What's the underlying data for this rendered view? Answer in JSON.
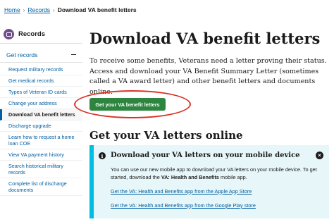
{
  "breadcrumb": {
    "items": [
      "Home",
      "Records"
    ],
    "current": "Download VA benefit letters",
    "separator": "›"
  },
  "sidebar": {
    "icon": "records-icon",
    "title": "Records",
    "section": "Get records",
    "section_toggle_icon": "minus-icon",
    "items": [
      {
        "label": "Request military records",
        "active": false
      },
      {
        "label": "Get medical records",
        "active": false
      },
      {
        "label": "Types of Veteran ID cards",
        "active": false
      },
      {
        "label": "Change your address",
        "active": false
      },
      {
        "label": "Download VA benefit letters",
        "active": true
      },
      {
        "label": "Discharge upgrade",
        "active": false
      },
      {
        "label": "Learn how to request a home loan COE",
        "active": false
      },
      {
        "label": "View VA payment history",
        "active": false
      },
      {
        "label": "Search historical military records",
        "active": false
      },
      {
        "label": "Complete list of discharge documents",
        "active": false
      }
    ]
  },
  "main": {
    "title": "Download VA benefit letters",
    "intro": "To receive some benefits, Veterans need a letter proving their status. Access and download your VA Benefit Summary Letter (sometimes called a VA award letter) and other benefit letters and documents online.",
    "cta_label": "Get your VA benefit letters",
    "section_title": "Get your VA letters online",
    "alert": {
      "icon": "info-icon",
      "info_glyph": "i",
      "close_icon": "close-icon",
      "close_glyph": "×",
      "title": "Download your VA letters on your mobile device",
      "body_prefix": "You can use our new mobile app to download your VA letters on your mobile device. To get started, download the ",
      "body_bold": "VA: Health and Benefits",
      "body_suffix": " mobile app.",
      "links": [
        "Get the VA: Health and Benefits app from the Apple App Store",
        "Get the VA: Health and Benefits app from the Google Play store"
      ]
    }
  },
  "colors": {
    "link": "#005ea2",
    "cta": "#2e8540",
    "annotation": "#d93226",
    "alert_bg": "#e7f6f8",
    "alert_border": "#00bde3",
    "records_icon": "#6f4e8c"
  }
}
